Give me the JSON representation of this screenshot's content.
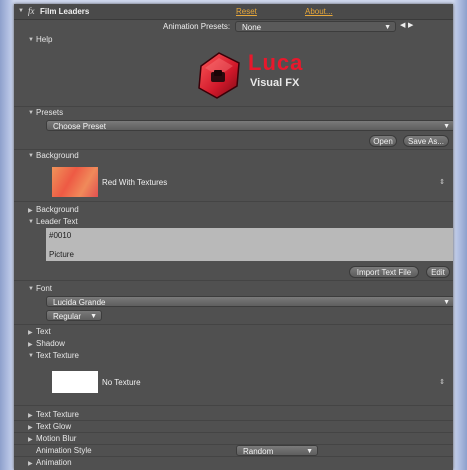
{
  "header": {
    "fx_label": "fx",
    "title": "Film Leaders",
    "reset": "Reset",
    "about": "About...",
    "presets_label": "Animation Presets:",
    "presets_value": "None"
  },
  "sections": {
    "help": "Help",
    "presets": "Presets",
    "background": "Background",
    "background2": "Background",
    "leader_text": "Leader Text",
    "font": "Font",
    "text": "Text",
    "shadow": "Shadow",
    "text_texture": "Text Texture",
    "text_texture2": "Text Texture",
    "text_glow": "Text Glow",
    "motion_blur": "Motion Blur",
    "animation_style": "Animation Style",
    "animation": "Animation"
  },
  "logo": {
    "line1": "Luca",
    "line2": "Visual FX"
  },
  "presets": {
    "choose": "Choose Preset",
    "open": "Open",
    "save_as": "Save As..."
  },
  "background": {
    "name": "Red With Textures"
  },
  "leader_text": {
    "line1": "#0010",
    "line2": "Picture",
    "import": "Import Text File",
    "edit": "Edit"
  },
  "font": {
    "family": "Lucida Grande",
    "style": "Regular"
  },
  "text_texture": {
    "name": "No Texture"
  },
  "animation_style": {
    "value": "Random"
  },
  "colors": {
    "panel_bg": "#505050",
    "link": "#e8a83a",
    "logo_red": "#d0182a",
    "swatch_red": "#ee5a44"
  }
}
